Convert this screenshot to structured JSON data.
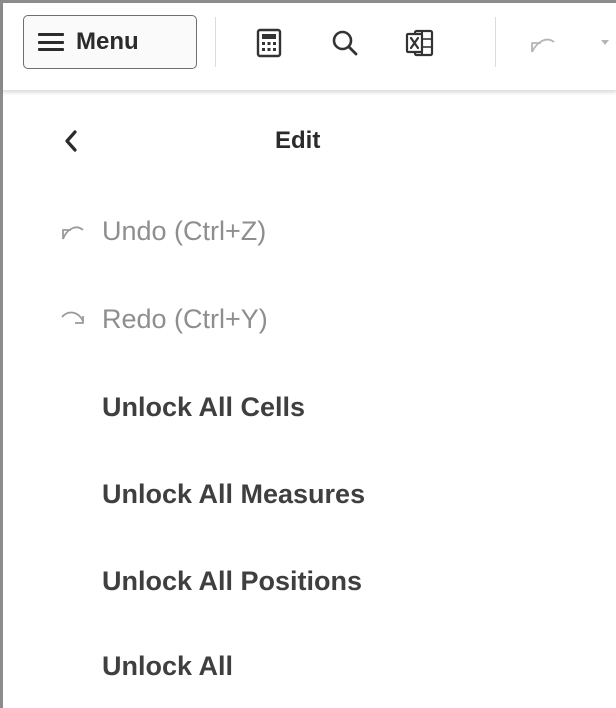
{
  "toolbar": {
    "menu_label": "Menu",
    "icons": {
      "calculator": "calculator-icon",
      "search": "search-icon",
      "excel": "excel-export-icon",
      "undo": "undo-icon",
      "dropdown": "chevron-down-icon"
    }
  },
  "panel": {
    "title": "Edit",
    "back_icon": "chevron-left-icon",
    "items": [
      {
        "label": "Undo (Ctrl+Z)",
        "icon": "undo-icon",
        "enabled": false
      },
      {
        "label": "Redo (Ctrl+Y)",
        "icon": "redo-icon",
        "enabled": false
      },
      {
        "label": "Unlock All Cells",
        "enabled": true
      },
      {
        "label": "Unlock All Measures",
        "enabled": true
      },
      {
        "label": "Unlock All Positions",
        "enabled": true
      },
      {
        "label": "Unlock All",
        "enabled": true
      }
    ]
  },
  "colors": {
    "text": "#3f3f3f",
    "disabled_text": "#8e8e8e",
    "border": "#8c8c8c"
  }
}
